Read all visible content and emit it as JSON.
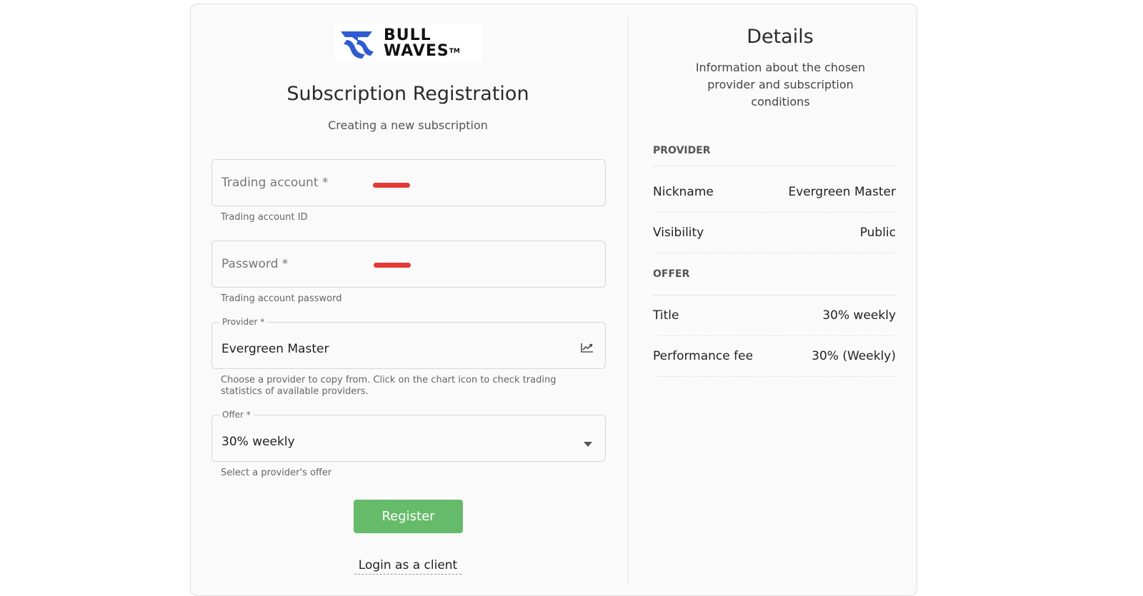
{
  "brand": {
    "logo_line1": "BULL",
    "logo_line2": "WAVES",
    "logo_tm": "TM",
    "accent_color": "#2f5bd3"
  },
  "form": {
    "title": "Subscription Registration",
    "subtitle": "Creating a new subscription",
    "trading_account": {
      "label": "Trading account *",
      "helper": "Trading account ID",
      "value": ""
    },
    "password": {
      "label": "Password *",
      "helper": "Trading account password",
      "value": ""
    },
    "provider": {
      "label": "Provider *",
      "value": "Evergreen Master",
      "helper": "Choose a provider to copy from. Click on the chart icon to check trading statistics of available providers.",
      "icon": "chart-icon"
    },
    "offer": {
      "label": "Offer *",
      "value": "30% weekly",
      "helper": "Select a provider's offer",
      "icon": "chevron-down-icon"
    },
    "register_label": "Register",
    "register_color": "#66bb6a",
    "login_label": "Login as a client"
  },
  "details": {
    "title": "Details",
    "description": "Information about the chosen provider and subscription conditions",
    "provider_section": "PROVIDER",
    "nickname_label": "Nickname",
    "nickname_value": "Evergreen Master",
    "visibility_label": "Visibility",
    "visibility_value": "Public",
    "offer_section": "OFFER",
    "offer_title_label": "Title",
    "offer_title_value": "30% weekly",
    "fee_label": "Performance fee",
    "fee_value": "30% (Weekly)"
  },
  "redaction_color": "#e53935"
}
